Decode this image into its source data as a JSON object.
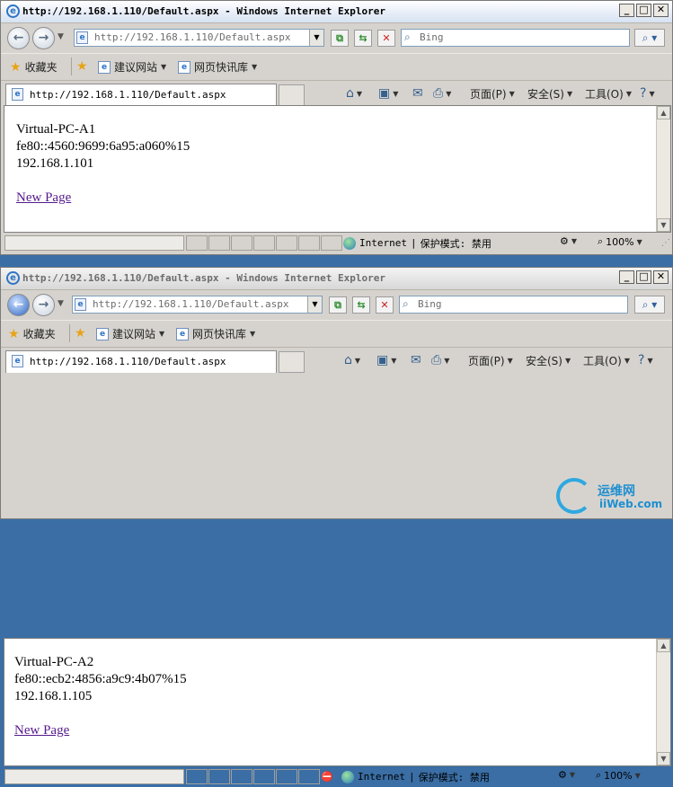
{
  "windows": [
    {
      "title": "http://192.168.1.110/Default.aspx - Windows Internet Explorer",
      "address": "http://192.168.1.110/Default.aspx",
      "search_placeholder": "Bing",
      "favorites": {
        "label": "收藏夹",
        "suggested": "建议网站",
        "slices": "网页快讯库"
      },
      "tab_title": "http://192.168.1.110/Default.aspx",
      "commands": {
        "page": "页面(P)",
        "safety": "安全(S)",
        "tools": "工具(O)"
      },
      "content": {
        "line1": "Virtual-PC-A1",
        "line2": "fe80::4560:9699:6a95:a060%15",
        "line3": "192.168.1.101",
        "link": "New Page"
      },
      "status": {
        "zone": "Internet",
        "protected_mode": "保护模式: 禁用",
        "zoom": "100%"
      }
    },
    {
      "title": "http://192.168.1.110/Default.aspx - Windows Internet Explorer",
      "address": "http://192.168.1.110/Default.aspx",
      "search_placeholder": "Bing",
      "favorites": {
        "label": "收藏夹",
        "suggested": "建议网站",
        "slices": "网页快讯库"
      },
      "tab_title": "http://192.168.1.110/Default.aspx",
      "commands": {
        "page": "页面(P)",
        "safety": "安全(S)",
        "tools": "工具(O)"
      },
      "content": {
        "line1": "Virtual-PC-A2",
        "line2": "fe80::ecb2:4856:a9c9:4b07%15",
        "line3": "192.168.1.105",
        "link": "New Page"
      },
      "status": {
        "zone": "Internet",
        "protected_mode": "保护模式: 禁用",
        "zoom": "100%"
      }
    }
  ],
  "watermark": {
    "text": "运维网",
    "sub": "iiWeb.com"
  },
  "icons": {
    "back": "back-arrow-icon",
    "forward": "forward-arrow-icon",
    "compat": "compatibility-view-icon",
    "refresh": "refresh-icon",
    "stop": "stop-icon",
    "search": "search-icon",
    "home": "home-icon",
    "feeds": "feeds-icon",
    "mail": "mail-icon",
    "print": "print-icon",
    "help": "help-icon",
    "globe": "internet-zone-icon"
  },
  "colors": {
    "link_visited": "#551a8b",
    "desktop": "#3a6ea5"
  }
}
